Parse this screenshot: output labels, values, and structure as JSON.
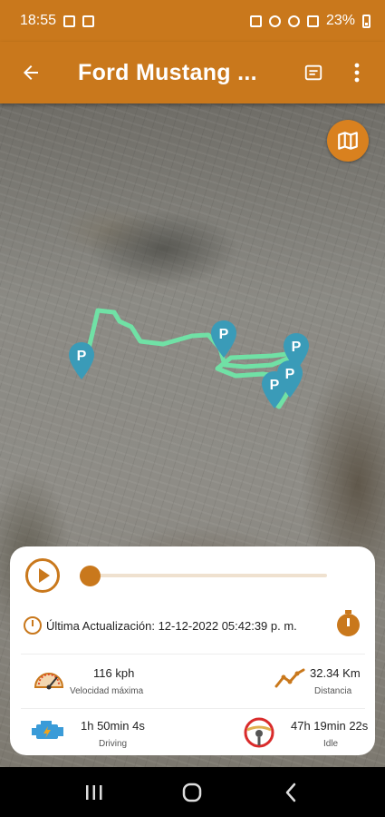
{
  "status_bar": {
    "time": "18:55",
    "battery": "23%"
  },
  "app_bar": {
    "title": "Ford Mustang ..."
  },
  "map": {
    "parking_markers": [
      {
        "label": "P"
      },
      {
        "label": "P"
      },
      {
        "label": "P"
      },
      {
        "label": "P"
      },
      {
        "label": "P"
      }
    ]
  },
  "panel": {
    "last_update_label": "Última Actualización:",
    "last_update_value": "12-12-2022 05:42:39 p. m.",
    "stats": {
      "max_speed_value": "116 kph",
      "max_speed_label": "Velocidad máxima",
      "distance_value": "32.34 Km",
      "distance_label": "Distancia",
      "driving_value": "1h 50min 4s",
      "driving_label": "Driving",
      "idle_value": "47h 19min 22s",
      "idle_label": "Idle"
    },
    "playback_progress": 0.0
  },
  "colors": {
    "accent": "#c9781c",
    "route": "#6ee8a8",
    "marker": "#3a9bb8"
  }
}
